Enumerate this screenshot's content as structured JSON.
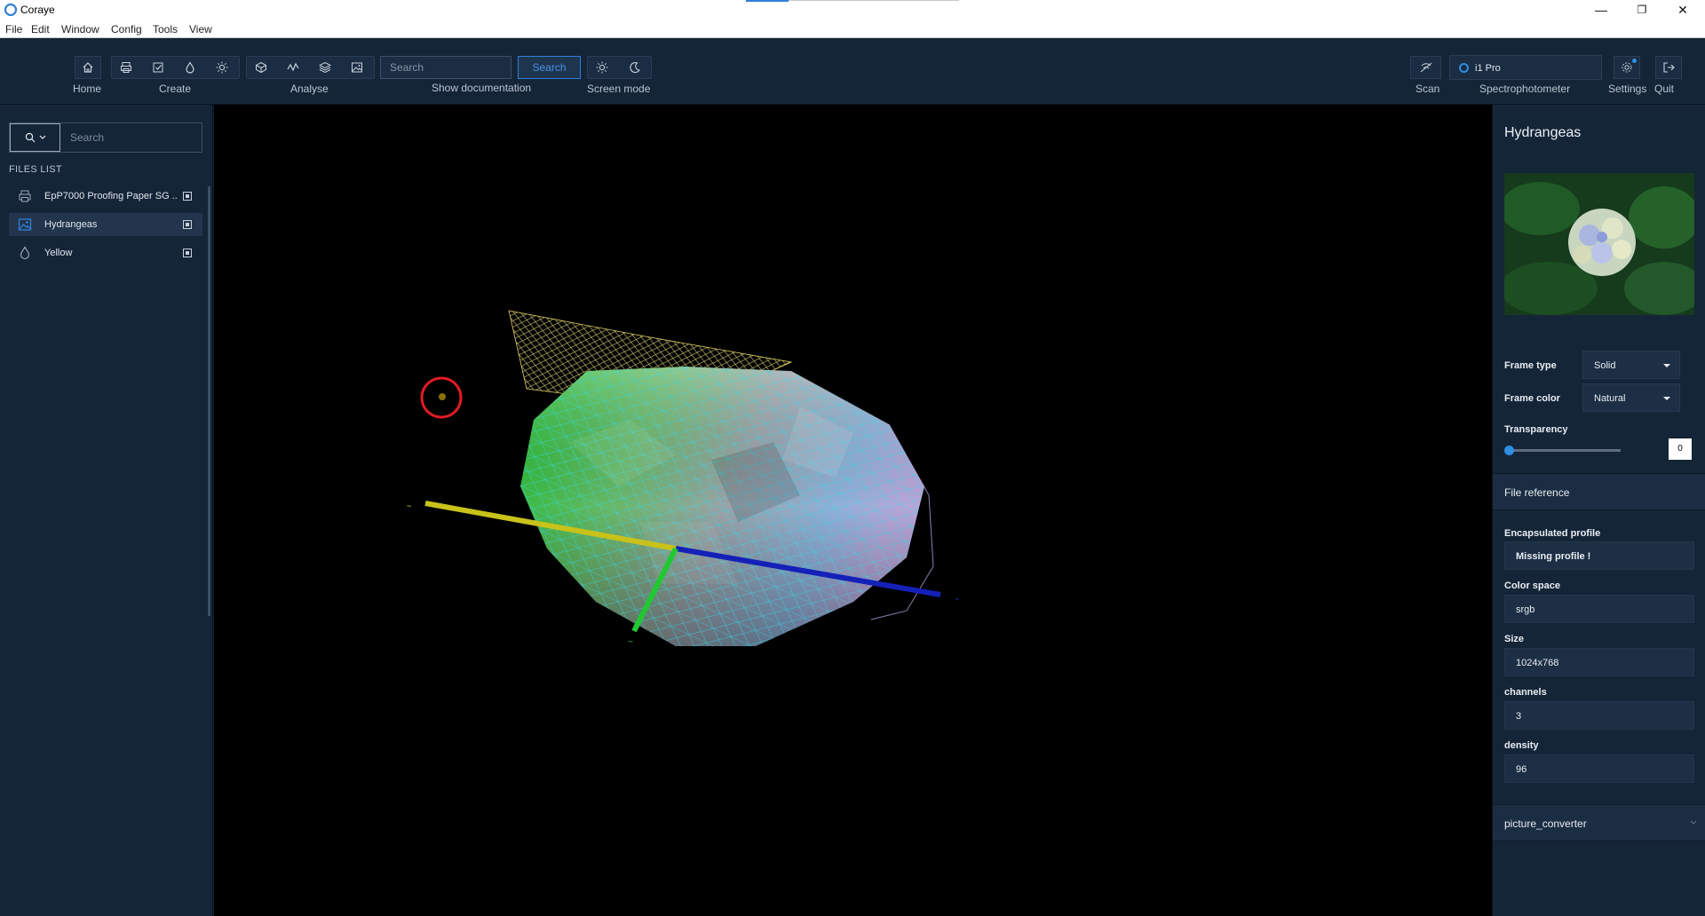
{
  "window": {
    "title": "Coraye",
    "minimize": "—",
    "restore": "❐",
    "close": "✕"
  },
  "menu": {
    "items": [
      "File",
      "Edit",
      "Window",
      "Config",
      "Tools",
      "View"
    ]
  },
  "toolbar": {
    "labels": {
      "home": "Home",
      "create": "Create",
      "analyse": "Analyse",
      "show_documentation": "Show documentation",
      "screen_mode": "Screen mode",
      "scan": "Scan",
      "spectrophotometer": "Spectrophotometer",
      "settings": "Settings",
      "quit": "Quit"
    },
    "search": {
      "placeholder": "Search",
      "button": "Search"
    },
    "spectrophotometer_value": "i1 Pro"
  },
  "sidebar": {
    "search_placeholder": "Search",
    "files_label": "FILES LIST",
    "files": [
      {
        "name": "EpP7000 Proofing Paper SG ...",
        "icon": "printer-icon",
        "active": false
      },
      {
        "name": "Hydrangeas",
        "icon": "image-icon",
        "active": true
      },
      {
        "name": "Yellow",
        "icon": "drop-icon",
        "active": false
      }
    ]
  },
  "right_panel": {
    "title": "Hydrangeas",
    "frame_type_label": "Frame type",
    "frame_type_value": "Solid",
    "frame_color_label": "Frame color",
    "frame_color_value": "Natural",
    "transparency_label": "Transparency",
    "transparency_value": "0",
    "file_reference_label": "File reference",
    "encapsulated_profile_label": "Encapsulated profile",
    "encapsulated_profile_value": "Missing profile !",
    "color_space_label": "Color space",
    "color_space_value": "srgb",
    "size_label": "Size",
    "size_value": "1024x768",
    "channels_label": "channels",
    "channels_value": "3",
    "density_label": "density",
    "density_value": "96",
    "converter_label": "picture_converter"
  },
  "colors": {
    "accent": "#2f7fd8",
    "background": "#152538",
    "viewport": "#000000",
    "highlight_circle": "#e01b24"
  }
}
